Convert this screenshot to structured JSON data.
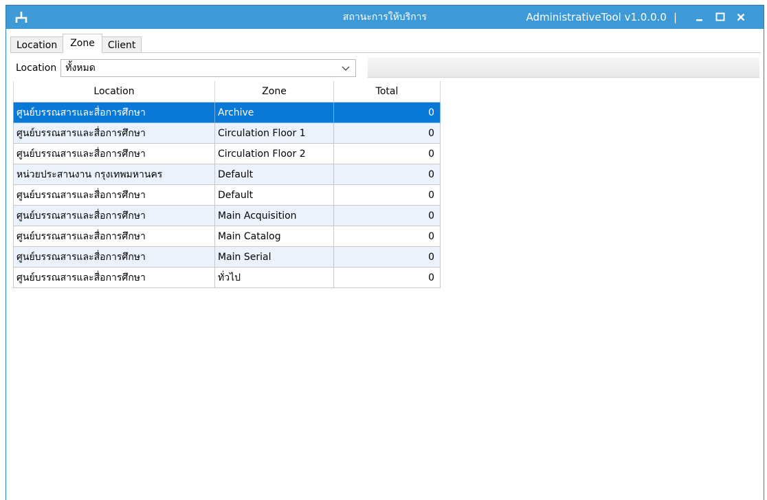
{
  "window": {
    "title": "สถานะการให้บริการ",
    "app_version": "AdministrativeTool v1.0.0.0",
    "separator": "|"
  },
  "colors": {
    "titlebar": "#3e9ad6",
    "selection": "#0a78d7",
    "alt_row": "#eaf3fd"
  },
  "tabs": [
    {
      "label": "Location",
      "active": false
    },
    {
      "label": "Zone",
      "active": true
    },
    {
      "label": "Client",
      "active": false
    }
  ],
  "filter": {
    "label": "Location",
    "selected": "ทั้งหมด"
  },
  "table": {
    "headers": [
      "Location",
      "Zone",
      "Total"
    ],
    "rows": [
      {
        "location": "ศูนย์บรรณสารและสื่อการศึกษา",
        "zone": "Archive",
        "total": "0",
        "selected": true
      },
      {
        "location": "ศูนย์บรรณสารและสื่อการศึกษา",
        "zone": "Circulation Floor 1",
        "total": "0"
      },
      {
        "location": "ศูนย์บรรณสารและสื่อการศึกษา",
        "zone": "Circulation Floor 2",
        "total": "0"
      },
      {
        "location": "หน่วยประสานงาน กรุงเทพมหานคร",
        "zone": "Default",
        "total": "0"
      },
      {
        "location": "ศูนย์บรรณสารและสื่อการศึกษา",
        "zone": "Default",
        "total": "0"
      },
      {
        "location": "ศูนย์บรรณสารและสื่อการศึกษา",
        "zone": "Main Acquisition",
        "total": "0"
      },
      {
        "location": "ศูนย์บรรณสารและสื่อการศึกษา",
        "zone": "Main Catalog",
        "total": "0"
      },
      {
        "location": "ศูนย์บรรณสารและสื่อการศึกษา",
        "zone": "Main Serial",
        "total": "0"
      },
      {
        "location": "ศูนย์บรรณสารและสื่อการศึกษา",
        "zone": "ทั่วไป",
        "total": "0"
      }
    ]
  }
}
